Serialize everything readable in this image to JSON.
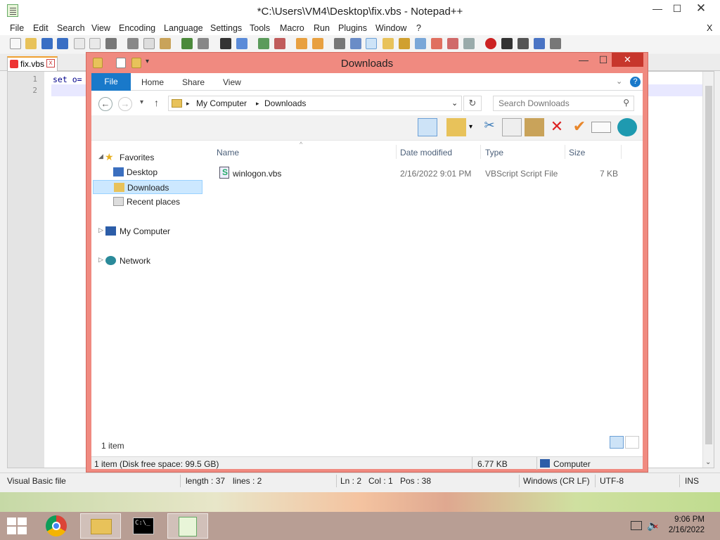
{
  "notepadpp": {
    "title": "*C:\\Users\\VM4\\Desktop\\fix.vbs - Notepad++",
    "menu": [
      "File",
      "Edit",
      "Search",
      "View",
      "Encoding",
      "Language",
      "Settings",
      "Tools",
      "Macro",
      "Run",
      "Plugins",
      "Window",
      "?"
    ],
    "menu_close": "X",
    "tab_label": "fix.vbs",
    "tab_close": "x",
    "line_numbers": [
      "1",
      "2"
    ],
    "code_line_1": "set o=",
    "status": {
      "file_type": "Visual Basic file",
      "length": "length : 37",
      "lines": "lines : 2",
      "ln": "Ln : 2",
      "col": "Col : 1",
      "pos": "Pos : 38",
      "eol": "Windows (CR LF)",
      "encoding": "UTF-8",
      "mode": "INS"
    }
  },
  "explorer": {
    "title": "Downloads",
    "ribbon_tabs": [
      "File",
      "Home",
      "Share",
      "View"
    ],
    "breadcrumb": [
      "My Computer",
      "Downloads"
    ],
    "search_placeholder": "Search Downloads",
    "nav": {
      "favorites": "Favorites",
      "desktop": "Desktop",
      "downloads": "Downloads",
      "recent_places": "Recent places",
      "my_computer": "My Computer",
      "network": "Network"
    },
    "columns": [
      "Name",
      "Date modified",
      "Type",
      "Size"
    ],
    "files": [
      {
        "name": "winlogon.vbs",
        "date_modified": "2/16/2022 9:01 PM",
        "type": "VBScript Script File",
        "size": "7 KB"
      }
    ],
    "item_count": "1 item",
    "status": {
      "disk_free": "1 item (Disk free space: 99.5 GB)",
      "size": "6.77 KB",
      "location": "Computer"
    }
  },
  "taskbar": {
    "time": "9:06 PM",
    "date": "2/16/2022"
  },
  "colors": {
    "explorer_frame": "#f08a80",
    "explorer_close": "#c7362c",
    "ribbon_file_tab": "#1979ca",
    "selection": "#cce8ff",
    "taskbar": "#b89e94"
  },
  "icons": [
    "notepadpp-icon",
    "folder-icon",
    "back-icon",
    "forward-icon",
    "up-icon",
    "refresh-icon",
    "search-icon",
    "star-icon",
    "desktop-icon",
    "computer-icon",
    "network-icon",
    "vbs-file-icon",
    "start-icon",
    "chrome-icon",
    "explorer-icon",
    "cmd-icon",
    "network-tray-icon",
    "volume-muted-icon",
    "cut-icon",
    "copy-icon",
    "paste-icon",
    "delete-icon",
    "check-icon",
    "help-icon"
  ]
}
